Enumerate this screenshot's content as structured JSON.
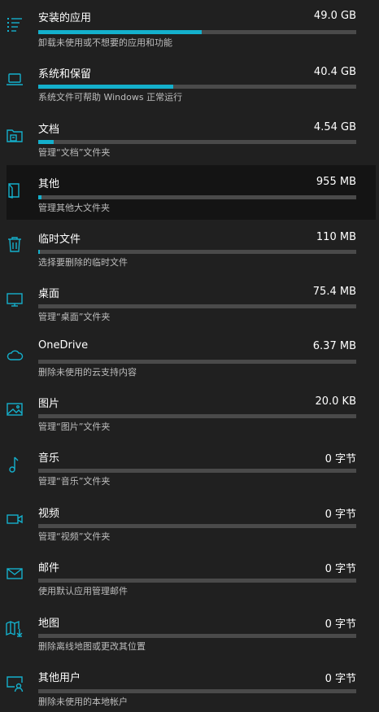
{
  "storage": {
    "accent_color": "#14b0cc",
    "items": [
      {
        "icon": "apps-list-icon",
        "name": "安装的应用",
        "size": "49.0 GB",
        "usage": 0.515,
        "description": "卸载未使用或不想要的应用和功能"
      },
      {
        "icon": "laptop-icon",
        "name": "系统和保留",
        "size": "40.4 GB",
        "usage": 0.425,
        "description": "系统文件可帮助 Windows 正常运行"
      },
      {
        "icon": "documents-folder-icon",
        "name": "文档",
        "size": "4.54 GB",
        "usage": 0.048,
        "description": "管理“文档”文件夹"
      },
      {
        "icon": "other-files-icon",
        "name": "其他",
        "size": "955 MB",
        "usage": 0.01,
        "description": "管理其他大文件夹",
        "highlighted": true
      },
      {
        "icon": "trash-icon",
        "name": "临时文件",
        "size": "110 MB",
        "usage": 0.002,
        "description": "选择要删除的临时文件"
      },
      {
        "icon": "desktop-monitor-icon",
        "name": "桌面",
        "size": "75.4 MB",
        "usage": 0.0,
        "description": "管理“桌面”文件夹"
      },
      {
        "icon": "cloud-icon",
        "name": "OneDrive",
        "size": "6.37 MB",
        "usage": 0.0,
        "description": "删除未使用的云支持内容"
      },
      {
        "icon": "picture-icon",
        "name": "图片",
        "size": "20.0 KB",
        "usage": 0.0,
        "description": "管理“图片”文件夹"
      },
      {
        "icon": "music-note-icon",
        "name": "音乐",
        "size": "0 字节",
        "usage": 0.0,
        "description": "管理“音乐”文件夹"
      },
      {
        "icon": "video-camera-icon",
        "name": "视频",
        "size": "0 字节",
        "usage": 0.0,
        "description": "管理“视频”文件夹"
      },
      {
        "icon": "mail-envelope-icon",
        "name": "邮件",
        "size": "0 字节",
        "usage": 0.0,
        "description": "使用默认应用管理邮件"
      },
      {
        "icon": "map-icon",
        "name": "地图",
        "size": "0 字节",
        "usage": 0.0,
        "description": "删除离线地图或更改其位置"
      },
      {
        "icon": "other-users-icon",
        "name": "其他用户",
        "size": "0 字节",
        "usage": 0.0,
        "description": "删除未使用的本地帐户"
      }
    ]
  }
}
